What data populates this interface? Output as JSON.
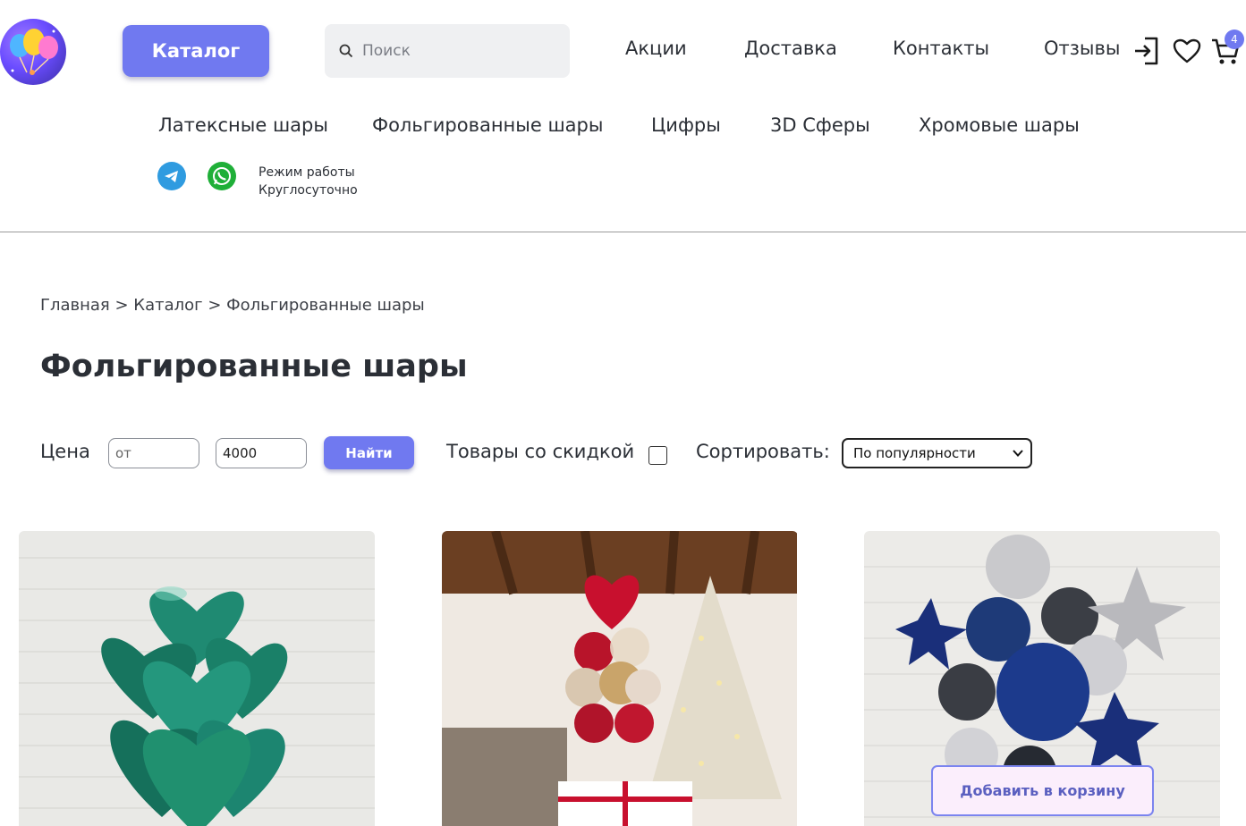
{
  "header": {
    "catalog_button": "Каталог",
    "search_placeholder": "Поиск",
    "nav": [
      "Акции",
      "Доставка",
      "Контакты",
      "Отзывы"
    ],
    "cart_count": "4"
  },
  "subnav": [
    "Латексные шары",
    "Фольгированные шары",
    "Цифры",
    "3D Сферы",
    "Хромовые шары"
  ],
  "contacts": {
    "hours_label": "Режим работы",
    "hours_value": "Круглосуточно"
  },
  "breadcrumb": {
    "home": "Главная",
    "catalog": "Каталог",
    "current": "Фольгированные шары",
    "separator": ">"
  },
  "page_title": "Фольгированные шары",
  "filters": {
    "price_label": "Цена",
    "price_from_placeholder": "от",
    "price_to_value": "4000",
    "find_button": "Найти",
    "discount_label": "Товары со скидкой",
    "discount_checked": false,
    "sort_label": "Сортировать:",
    "sort_selected": "По популярности"
  },
  "products": [
    {
      "image": "green-heart-foil-balloons"
    },
    {
      "image": "red-gold-heart-balloon-bouquet-christmas-tree"
    },
    {
      "image": "navy-silver-birthday-balloon-bouquet",
      "add_to_cart": "Добавить в корзину"
    }
  ],
  "colors": {
    "accent": "#7079f0",
    "text": "#2b2f36",
    "card_button_bg": "#fbeefc"
  }
}
